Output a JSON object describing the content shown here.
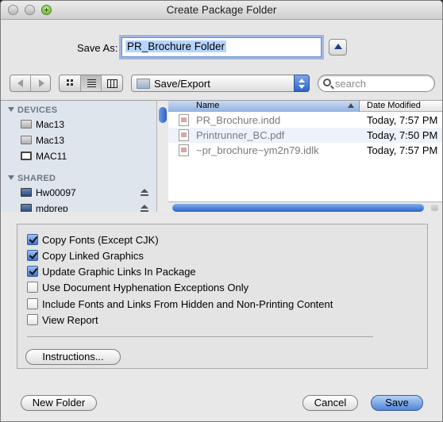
{
  "window": {
    "title": "Create Package Folder"
  },
  "save_as": {
    "label": "Save As:",
    "value": "PR_Brochure Folder"
  },
  "location": {
    "folder": "Save/Export"
  },
  "search": {
    "placeholder": "search"
  },
  "sidebar": {
    "devices_header": "DEVICES",
    "devices": [
      {
        "label": "Mac13",
        "icon": "hard-drive-icon"
      },
      {
        "label": "Mac13",
        "icon": "hard-drive-icon"
      },
      {
        "label": "MAC11",
        "icon": "network-computer-icon"
      }
    ],
    "shared_header": "SHARED",
    "shared": [
      {
        "label": "Hw00097",
        "icon": "imac-icon"
      },
      {
        "label": "mdprep",
        "icon": "imac-icon"
      }
    ]
  },
  "file_list": {
    "columns": {
      "name": "Name",
      "date": "Date Modified"
    },
    "rows": [
      {
        "name": "PR_Brochure.indd",
        "date": "Today, 7:57 PM"
      },
      {
        "name": "Printrunner_BC.pdf",
        "date": "Today, 7:50 PM"
      },
      {
        "name": "~pr_brochure~ym2n79.idlk",
        "date": "Today, 7:57 PM"
      }
    ]
  },
  "options": [
    {
      "label": "Copy Fonts (Except CJK)",
      "checked": true
    },
    {
      "label": "Copy Linked Graphics",
      "checked": true
    },
    {
      "label": "Update Graphic Links In Package",
      "checked": true
    },
    {
      "label": "Use Document Hyphenation Exceptions Only",
      "checked": false
    },
    {
      "label": "Include Fonts and Links From Hidden and Non-Printing Content",
      "checked": false
    },
    {
      "label": "View Report",
      "checked": false
    }
  ],
  "buttons": {
    "instructions": "Instructions...",
    "new_folder": "New Folder",
    "cancel": "Cancel",
    "save": "Save"
  },
  "colors": {
    "accent": "#3c73d0",
    "selection": "#b5d5ff"
  }
}
